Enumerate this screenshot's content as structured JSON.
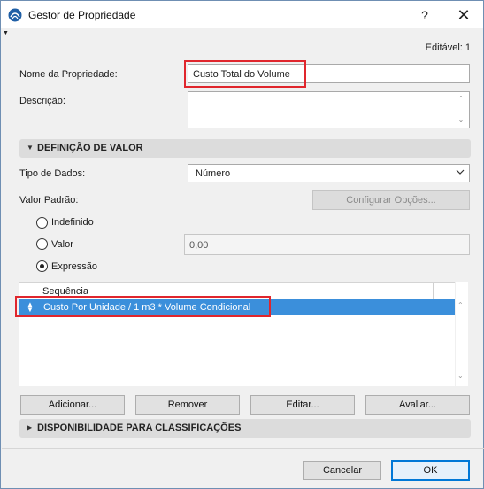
{
  "window": {
    "title": "Gestor de Propriedade",
    "help_glyph": "?",
    "close_glyph": "✕"
  },
  "editable": "Editável: 1",
  "property_name": {
    "label": "Nome da Propriedade:",
    "value": "Custo Total do Volume"
  },
  "description": {
    "label": "Descrição:",
    "value": ""
  },
  "value_definition": {
    "section_title": "DEFINIÇÃO DE VALOR",
    "data_type": {
      "label": "Tipo de Dados:",
      "value": "Número"
    },
    "default_value": {
      "label": "Valor Padrão:"
    },
    "configure_options_button": "Configurar Opções...",
    "radios": [
      {
        "label": "Indefinido",
        "checked": false
      },
      {
        "label": "Valor",
        "checked": false
      },
      {
        "label": "Expressão",
        "checked": true
      }
    ],
    "value_field": "0,00"
  },
  "sequence_list": {
    "column_header": "Sequência",
    "rows": [
      {
        "text": "Custo Por Unidade / 1 m3 * Volume Condicional",
        "selected": true
      }
    ]
  },
  "list_buttons": {
    "add": "Adicionar...",
    "remove": "Remover",
    "edit": "Editar...",
    "evaluate": "Avaliar..."
  },
  "classification_section": {
    "title": "DISPONIBILIDADE PARA CLASSIFICAÇÕES"
  },
  "footer": {
    "cancel": "Cancelar",
    "ok": "OK"
  },
  "colors": {
    "highlight": "#e0262d",
    "selection": "#3b8fdb",
    "primary_border": "#0078d7"
  }
}
